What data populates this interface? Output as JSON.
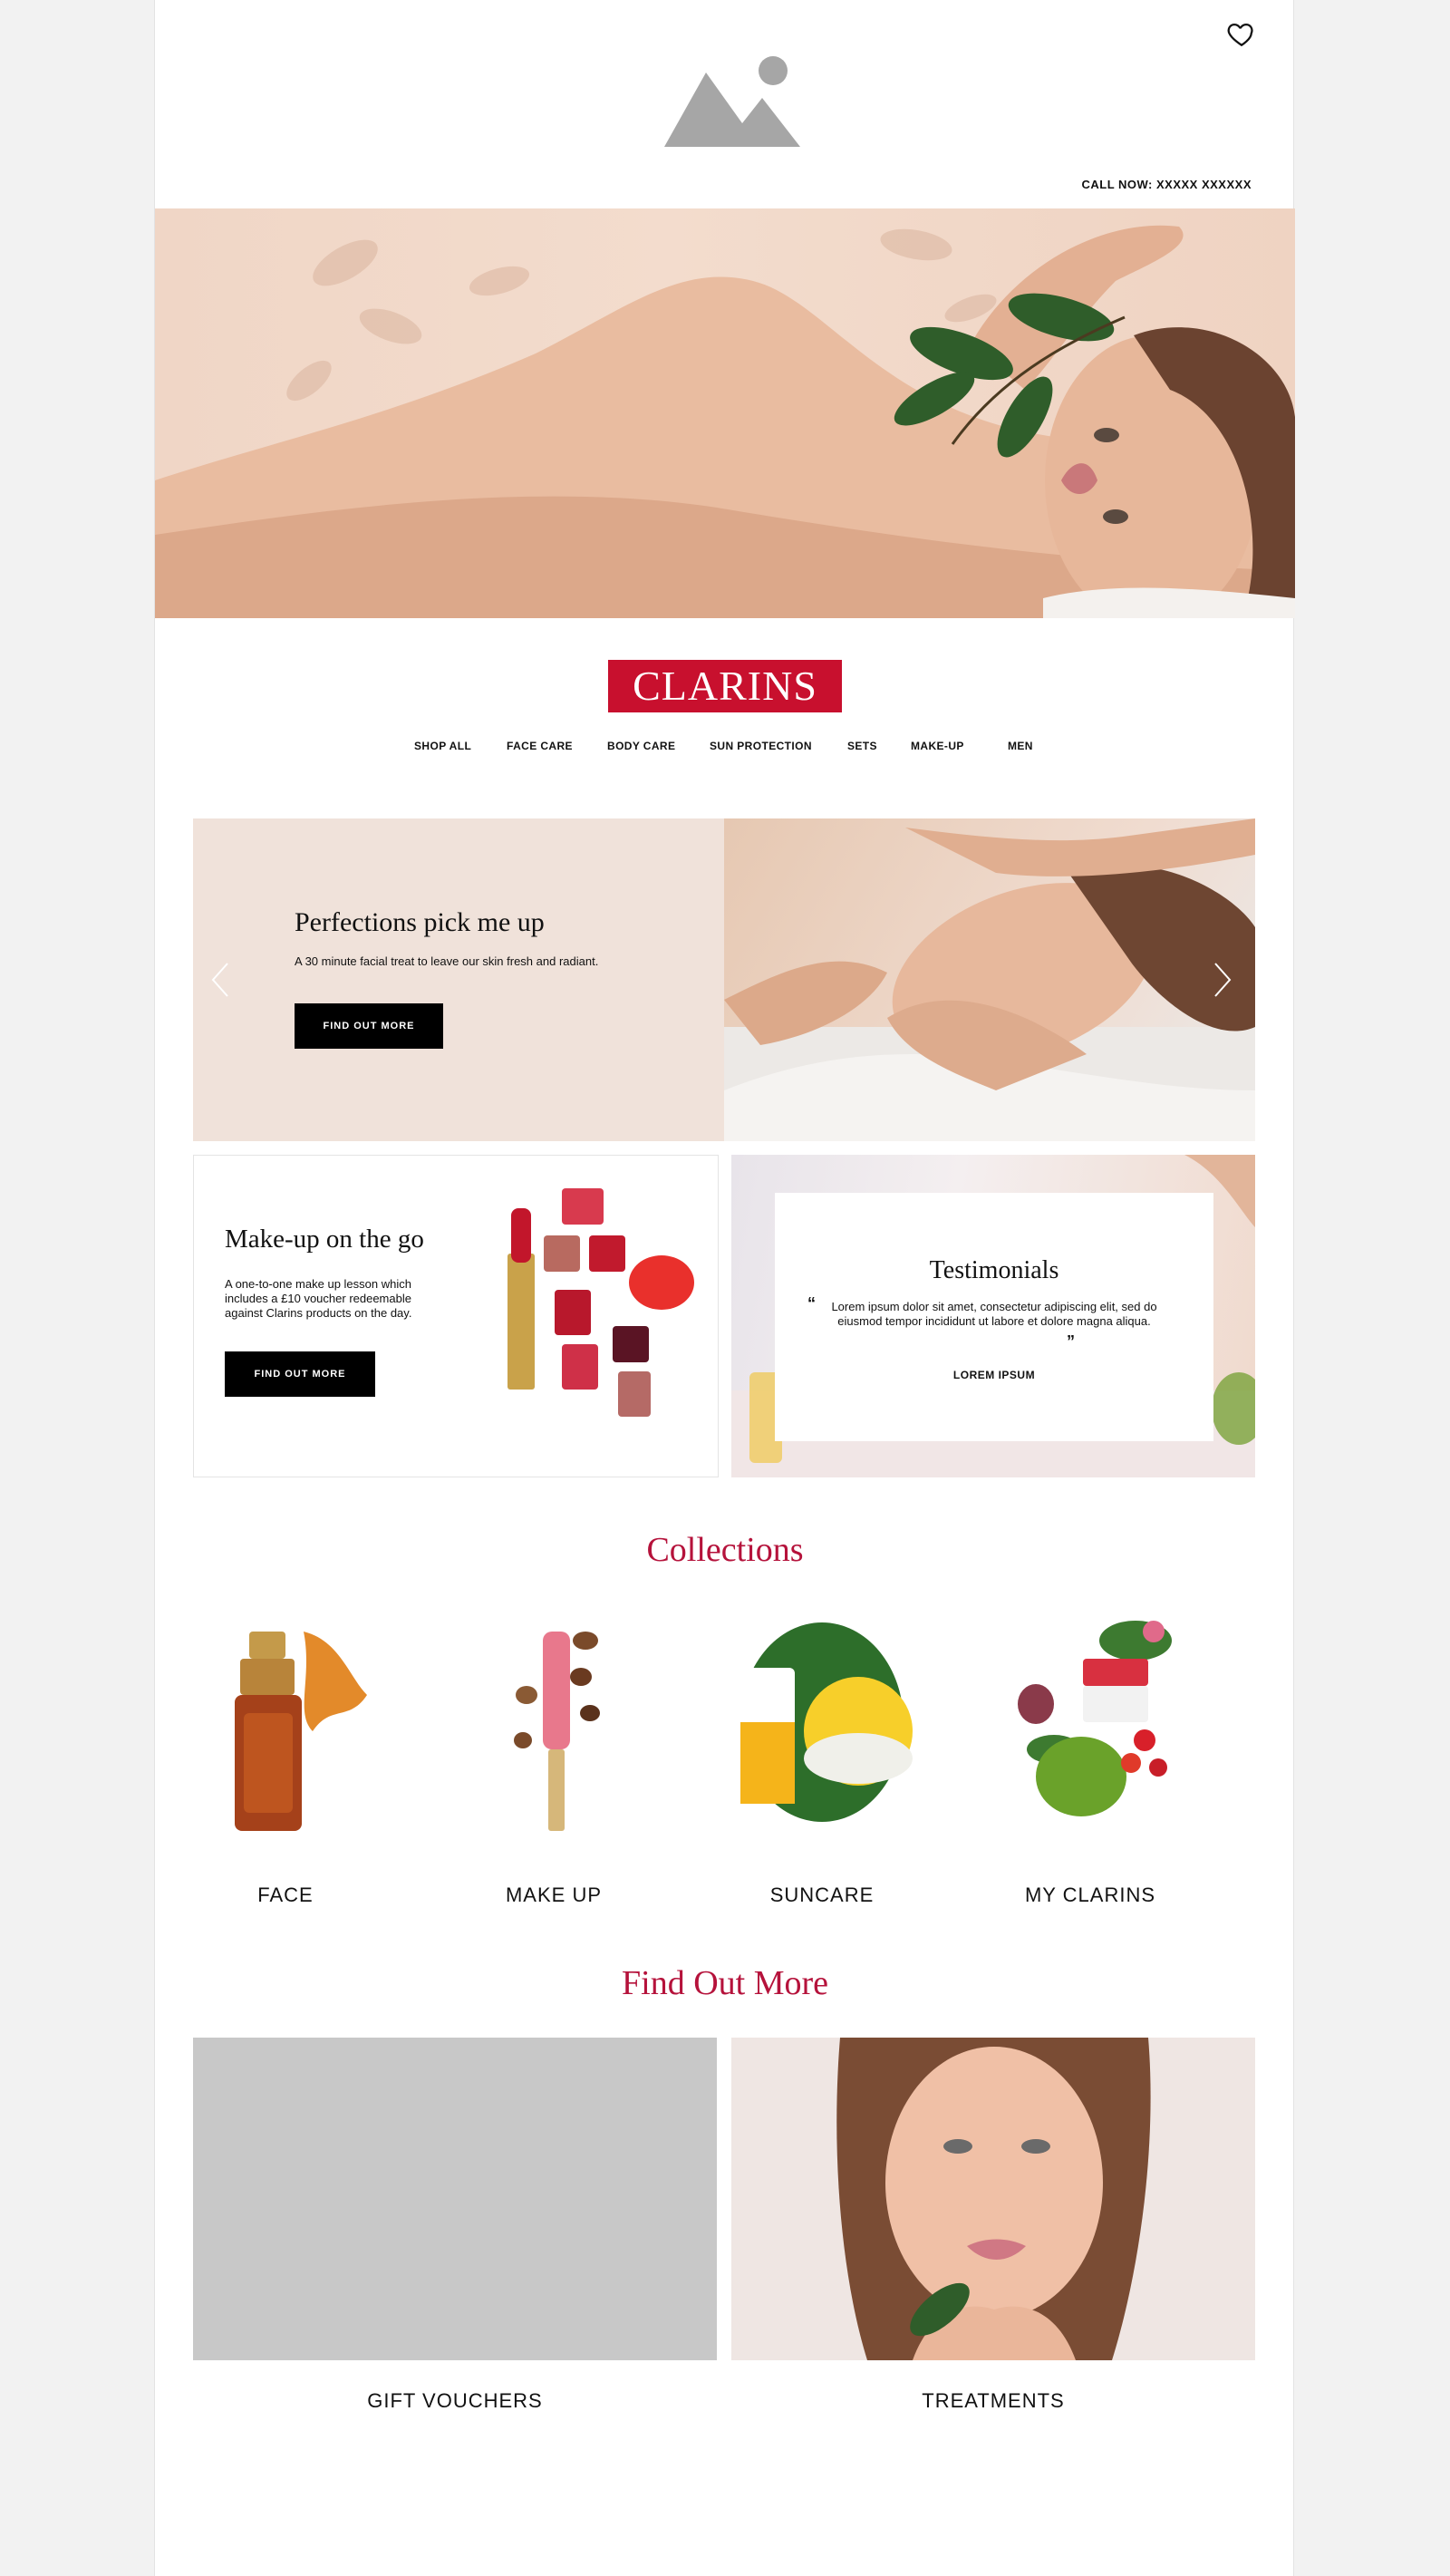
{
  "header": {
    "call_now": "CALL NOW: XXXXX XXXXXX",
    "logo_placeholder_icon": "image-placeholder-icon",
    "wishlist_icon": "heart-icon"
  },
  "brand": {
    "name": "CLARINS",
    "color": "#c8102e"
  },
  "nav": {
    "items": [
      "SHOP ALL",
      "FACE CARE",
      "BODY CARE",
      "SUN PROTECTION",
      "SETS",
      "MAKE-UP",
      "MEN"
    ]
  },
  "banner": {
    "title": "Perfections pick me up",
    "text": "A 30 minute facial treat to leave our skin fresh and radiant.",
    "button": "FIND OUT MORE",
    "prev_icon": "chevron-left-icon",
    "next_icon": "chevron-right-icon"
  },
  "makeup": {
    "title": "Make-up on the go",
    "text": "A one-to-one make up lesson which includes a £10 voucher redeemable against Clarins products on the day.",
    "button": "FIND OUT MORE"
  },
  "testimonials": {
    "title": "Testimonials",
    "quote": "Lorem ipsum dolor sit amet, consectetur adipiscing elit, sed do eiusmod tempor incididunt ut labore et dolore magna aliqua.",
    "open_quote": "“",
    "close_quote": "”",
    "author": "LOREM IPSUM"
  },
  "collections": {
    "title": "Collections",
    "items": [
      "FACE",
      "MAKE UP",
      "SUNCARE",
      "MY CLARINS"
    ]
  },
  "find_out_more": {
    "title": "Find Out More",
    "items": [
      "GIFT VOUCHERS",
      "TREATMENTS"
    ]
  },
  "colors": {
    "accent": "#b5123b",
    "button": "#000000",
    "page_bg": "#f2f2f2"
  }
}
